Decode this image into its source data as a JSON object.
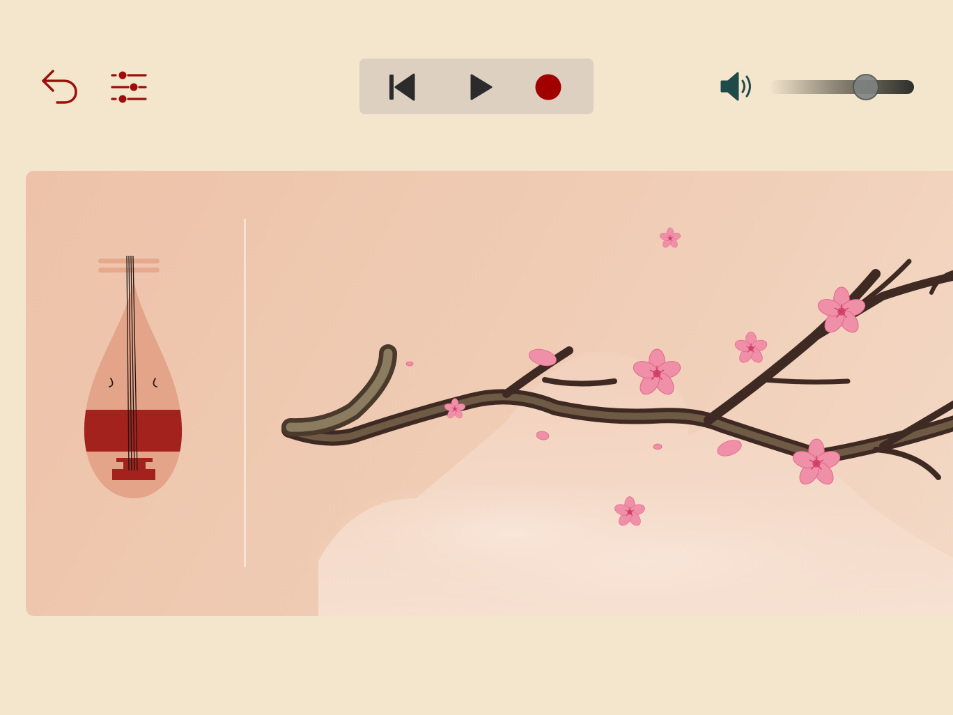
{
  "toolbar": {
    "back_icon": "undo-arrow-icon",
    "settings_icon": "sliders-icon",
    "accent_color": "#9b0f0b"
  },
  "transport": {
    "prev_icon": "skip-back-icon",
    "play_icon": "play-icon",
    "record_icon": "record-icon",
    "record_color": "#a00000",
    "icon_color": "#2b2b2b",
    "background": "#ddd0c0"
  },
  "volume": {
    "icon": "speaker-icon",
    "icon_color": "#1f4a4a",
    "level": 0.67
  },
  "stage": {
    "instrument": "pipa",
    "instrument_icon": "pipa-icon",
    "scene": "plum-blossom-branch-with-misty-mountains",
    "background": "#efc7ae"
  }
}
